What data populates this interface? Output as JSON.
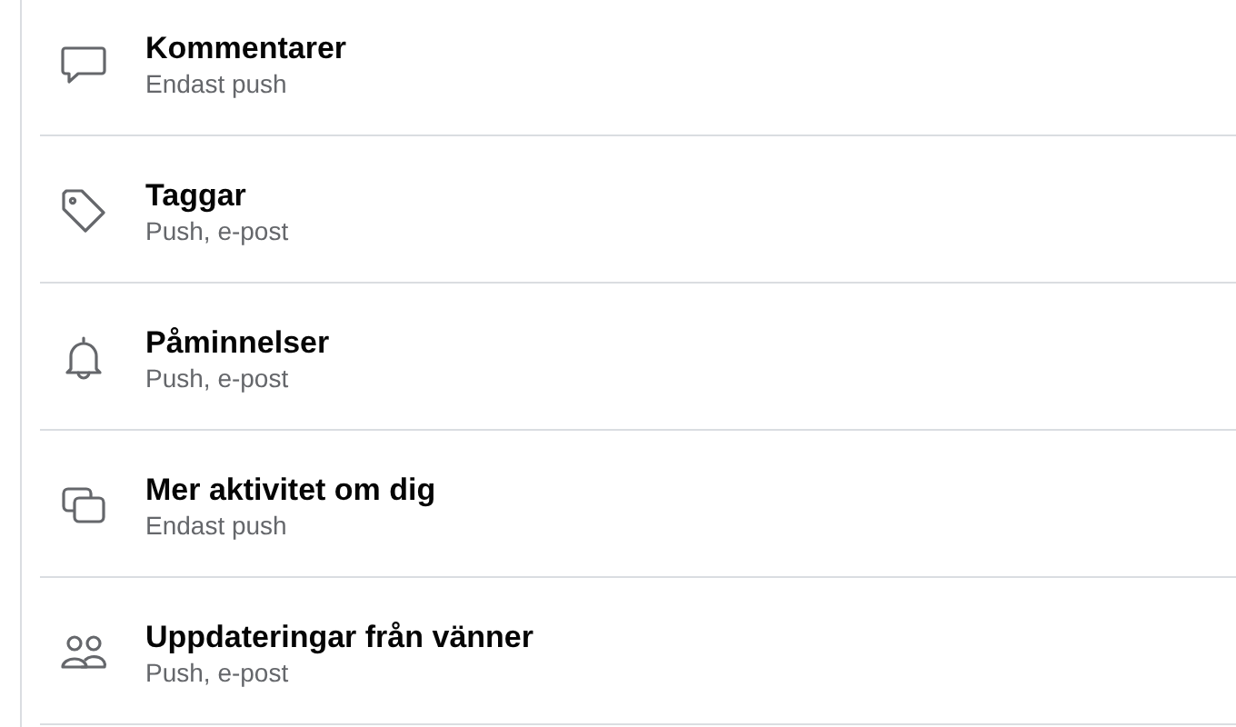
{
  "settings": [
    {
      "title": "Kommentarer",
      "subtitle": "Endast push"
    },
    {
      "title": "Taggar",
      "subtitle": "Push, e-post"
    },
    {
      "title": "Påminnelser",
      "subtitle": "Push, e-post"
    },
    {
      "title": "Mer aktivitet om dig",
      "subtitle": "Endast push"
    },
    {
      "title": "Uppdateringar från vänner",
      "subtitle": "Push, e-post"
    }
  ]
}
